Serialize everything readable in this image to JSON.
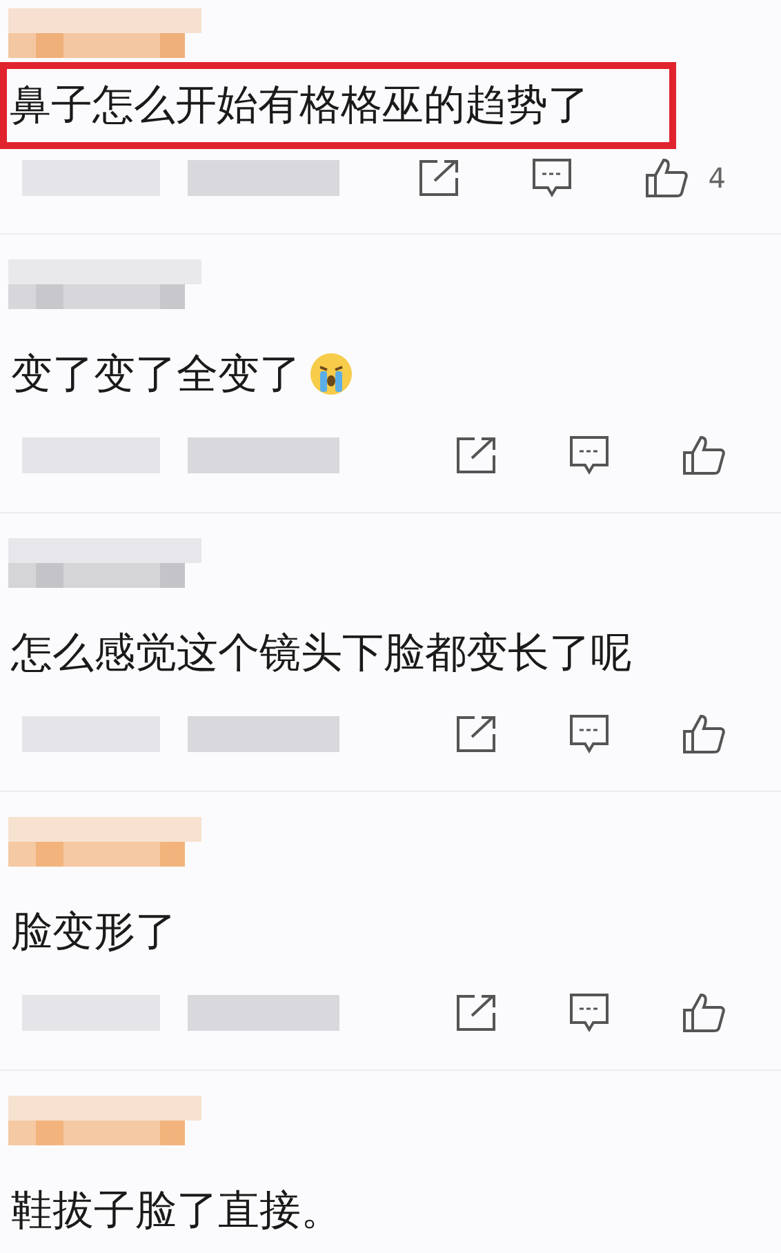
{
  "comments": [
    {
      "color": "#f0b07a",
      "highlighted": true,
      "text": "鼻子怎么开始有格格巫的趋势了",
      "crying_emoji": false,
      "likes": "4"
    },
    {
      "color": "#c8c8cc",
      "highlighted": false,
      "text": "变了变了全变了",
      "crying_emoji": true
    },
    {
      "color": "#c4c4c8",
      "highlighted": false,
      "text": "怎么感觉这个镜头下脸都变长了呢",
      "crying_emoji": false
    },
    {
      "color": "#f2b47c",
      "highlighted": false,
      "text": "脸变形了",
      "crying_emoji": false
    },
    {
      "color": "#f2b47c",
      "highlighted": false,
      "text": "鞋拔子脸了直接。",
      "crying_emoji": false
    }
  ]
}
